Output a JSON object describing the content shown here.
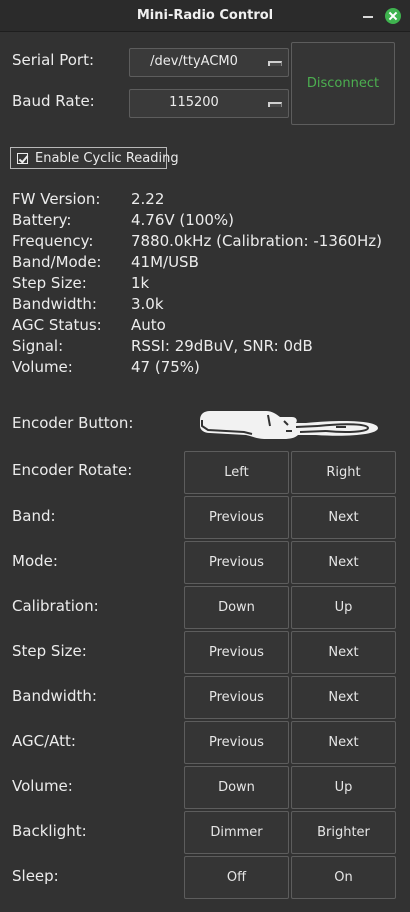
{
  "window": {
    "title": "Mini-Radio Control"
  },
  "connection": {
    "serial_port_label": "Serial Port:",
    "serial_port_value": "/dev/ttyACM0",
    "baud_rate_label": "Baud Rate:",
    "baud_rate_value": "115200",
    "disconnect_label": "Disconnect",
    "disconnect_color": "#4caf50"
  },
  "cyclic": {
    "label": "Enable Cyclic Reading",
    "checked": true
  },
  "info": [
    {
      "label": "FW Version:",
      "value": "2.22"
    },
    {
      "label": "Battery:",
      "value": "4.76V (100%)"
    },
    {
      "label": "Frequency:",
      "value": "7880.0kHz (Calibration: -1360Hz)"
    },
    {
      "label": "Band/Mode:",
      "value": "41M/USB"
    },
    {
      "label": "Step Size:",
      "value": "1k"
    },
    {
      "label": "Bandwidth:",
      "value": "3.0k"
    },
    {
      "label": "AGC Status:",
      "value": "Auto"
    },
    {
      "label": "Signal:",
      "value": "RSSI: 29dBuV, SNR: 0dB"
    },
    {
      "label": "Volume:",
      "value": "47 (75%)"
    }
  ],
  "encoder_button": {
    "label": "Encoder Button:",
    "icon": "hand-pointing-icon"
  },
  "controls": [
    {
      "label": "Encoder Rotate:",
      "left": "Left",
      "right": "Right"
    },
    {
      "label": "Band:",
      "left": "Previous",
      "right": "Next"
    },
    {
      "label": "Mode:",
      "left": "Previous",
      "right": "Next"
    },
    {
      "label": "Calibration:",
      "left": "Down",
      "right": "Up"
    },
    {
      "label": "Step Size:",
      "left": "Previous",
      "right": "Next"
    },
    {
      "label": "Bandwidth:",
      "left": "Previous",
      "right": "Next"
    },
    {
      "label": "AGC/Att:",
      "left": "Previous",
      "right": "Next"
    },
    {
      "label": "Volume:",
      "left": "Down",
      "right": "Up"
    },
    {
      "label": "Backlight:",
      "left": "Dimmer",
      "right": "Brighter"
    },
    {
      "label": "Sleep:",
      "left": "Off",
      "right": "On"
    }
  ]
}
